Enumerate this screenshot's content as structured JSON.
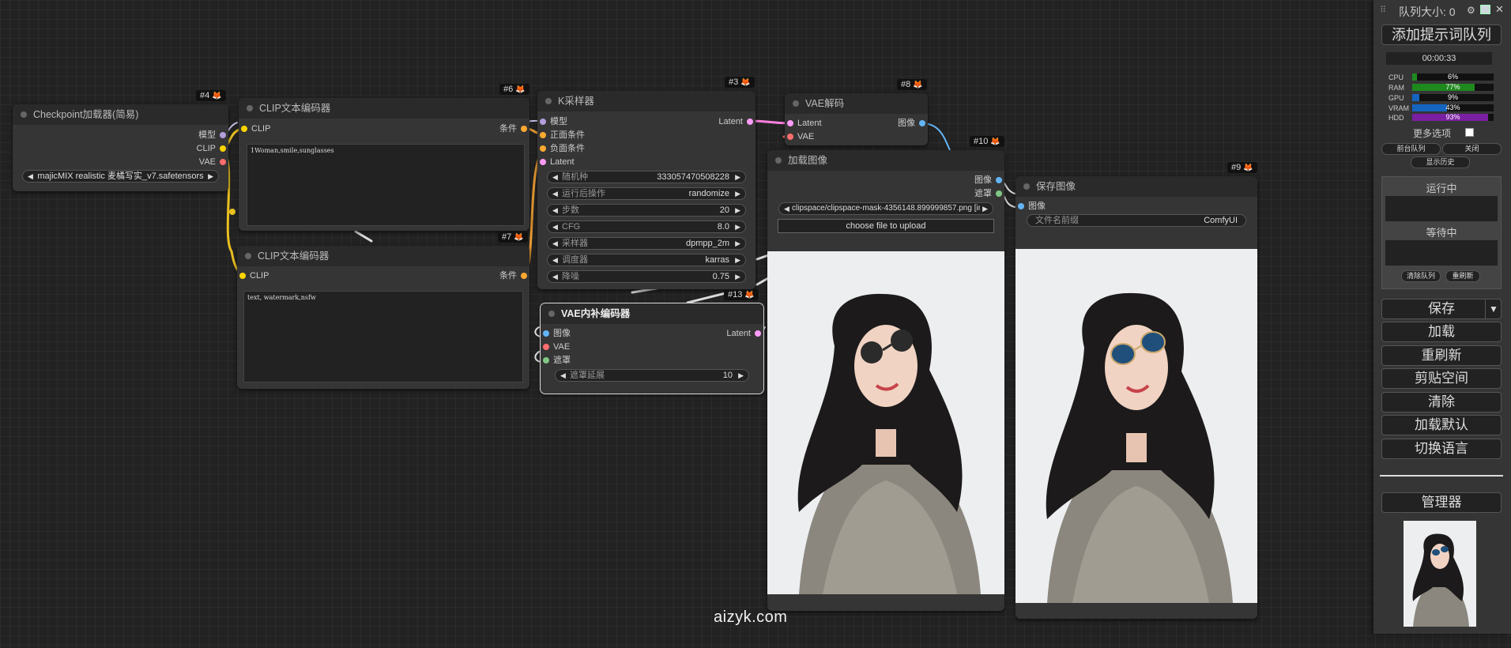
{
  "colors": {
    "model": "#b39ddb",
    "clip": "#ffd500",
    "vae": "#ff6e6e",
    "conditioning": "#ffa931",
    "latent": "#ff9cf9",
    "image": "#64b5f6",
    "mask": "#81c784",
    "link_clip": "#f5c518",
    "link_cond": "#f0a030",
    "link_latent": "#ff80e0",
    "link_image": "#64b5f6",
    "link_white": "#dddddd"
  },
  "nodes": {
    "n4": {
      "badge": "#4",
      "title": "Checkpoint加载器(简易)",
      "outputs": [
        "模型",
        "CLIP",
        "VAE"
      ],
      "ckpt_value": "majicMIX realistic 麦橘写实_v7.safetensors"
    },
    "n6": {
      "badge": "#6",
      "title": "CLIP文本编码器",
      "input": "CLIP",
      "output": "条件",
      "text": "1Woman,smile,sunglasses"
    },
    "n7": {
      "badge": "#7",
      "title": "CLIP文本编码器",
      "input": "CLIP",
      "output": "条件",
      "text": "text, watermark,nsfw"
    },
    "n3": {
      "badge": "#3",
      "title": "K采样器",
      "inputs": [
        "模型",
        "正面条件",
        "负面条件",
        "Latent"
      ],
      "output": "Latent",
      "widgets": [
        {
          "label": "随机种",
          "value": "333057470508228"
        },
        {
          "label": "运行后操作",
          "value": "randomize"
        },
        {
          "label": "步数",
          "value": "20"
        },
        {
          "label": "CFG",
          "value": "8.0"
        },
        {
          "label": "采样器",
          "value": "dpmpp_2m"
        },
        {
          "label": "调度器",
          "value": "karras"
        },
        {
          "label": "降噪",
          "value": "0.75"
        }
      ]
    },
    "n8": {
      "badge": "#8",
      "title": "VAE解码",
      "inputs": [
        "Latent",
        "VAE"
      ],
      "output": "图像"
    },
    "n13": {
      "badge": "#13",
      "title": "VAE内补编码器",
      "inputs": [
        "图像",
        "VAE",
        "遮罩"
      ],
      "output": "Latent",
      "widget": {
        "label": "遮罩延展",
        "value": "10"
      }
    },
    "n10": {
      "badge": "#10",
      "title": "加载图像",
      "outputs": [
        "图像",
        "遮罩"
      ],
      "image_value": "clipspace/clipspace-mask-4356148.899999857.png [input]",
      "upload_label": "choose file to upload"
    },
    "n9": {
      "badge": "#9",
      "title": "保存图像",
      "input": "图像",
      "widget": {
        "label": "文件名前缀",
        "value": "ComfyUI"
      }
    }
  },
  "menu": {
    "queue_size_label": "队列大小: 0",
    "queue_prompt": "添加提示词队列",
    "timer": "00:00:33",
    "stats": [
      {
        "label": "CPU",
        "value": "6%",
        "fraction": 0.06,
        "color": "#1e8a1e"
      },
      {
        "label": "RAM",
        "value": "77%",
        "fraction": 0.77,
        "color": "#1e8a1e"
      },
      {
        "label": "GPU",
        "value": "9%",
        "fraction": 0.09,
        "color": "#1565c0"
      },
      {
        "label": "VRAM",
        "value": "43%",
        "fraction": 0.43,
        "color": "#1565c0"
      },
      {
        "label": "HDD",
        "value": "93%",
        "fraction": 0.93,
        "color": "#7b1fa2"
      }
    ],
    "more_options": "更多选项",
    "front_queue": "前台队列",
    "close": "关闭",
    "show_history": "显示历史",
    "running": "运行中",
    "pending": "等待中",
    "clear_queue": "清除队列",
    "refresh_small": "重刷新",
    "save": "保存",
    "save_arrow": "▼",
    "load": "加载",
    "refresh": "重刷新",
    "clipspace": "剪贴空间",
    "clear": "清除",
    "load_default": "加载默认",
    "switch_language": "切换语言",
    "manager": "管理器"
  },
  "watermark": "aizyk.com"
}
